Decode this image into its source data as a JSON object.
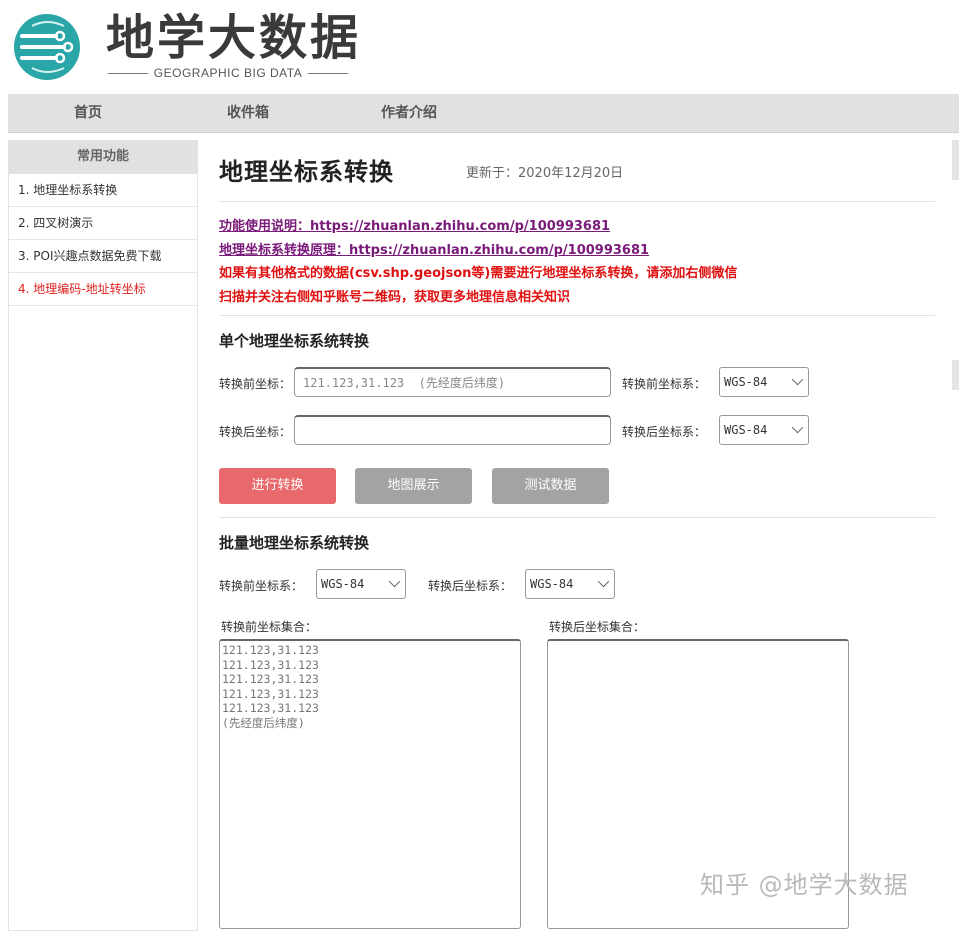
{
  "brand": {
    "title": "地学大数据",
    "subtitle": "GEOGRAPHIC BIG DATA",
    "accent": "#2aa6a8"
  },
  "topnav": {
    "items": [
      "首页",
      "收件箱",
      "作者介绍"
    ]
  },
  "sidebar": {
    "header": "常用功能",
    "items": [
      {
        "label": "1. 地理坐标系转换",
        "active": false
      },
      {
        "label": "2. 四叉树演示",
        "active": false
      },
      {
        "label": "3. POI兴趣点数据免费下载",
        "active": false
      },
      {
        "label": "4. 地理编码-地址转坐标",
        "active": true
      }
    ]
  },
  "main": {
    "title": "地理坐标系转换",
    "update_time": "更新于：2020年12月20日",
    "notices": {
      "usage_link": "功能使用说明：https://zhuanlan.zhihu.com/p/100993681",
      "principle_link": "地理坐标系转换原理：https://zhuanlan.zhihu.com/p/100993681",
      "other_formats": "如果有其他格式的数据(csv.shp.geojson等)需要进行地理坐标系转换，请添加右侧微信",
      "qr_hint": "扫描并关注右侧知乎账号二维码，获取更多地理信息相关知识"
    },
    "single": {
      "title": "单个地理坐标系统转换",
      "before_label": "转换前坐标：",
      "before_placeholder": "121.123,31.123  (先经度后纬度)",
      "before_value": "",
      "after_label": "转换后坐标：",
      "after_value": "",
      "before_crs_label": "转换前坐标系：",
      "before_crs_value": "WGS-84",
      "after_crs_label": "转换后坐标系：",
      "after_crs_value": "WGS-84",
      "convert_button": "进行转换",
      "map_button": "地图展示",
      "test_button": "测试数据"
    },
    "batch": {
      "title": "批量地理坐标系统转换",
      "before_crs_label": "转换前坐标系：",
      "before_crs_value": "WGS-84",
      "after_crs_label": "转换后坐标系：",
      "after_crs_value": "WGS-84",
      "before_set_label": "转换前坐标集合：",
      "before_set_placeholder": "121.123,31.123\n121.123,31.123\n121.123,31.123\n121.123,31.123\n121.123,31.123\n(先经度后纬度)",
      "after_set_label": "转换后坐标集合：",
      "after_set_value": ""
    }
  },
  "watermark": "知乎 @地学大数据"
}
